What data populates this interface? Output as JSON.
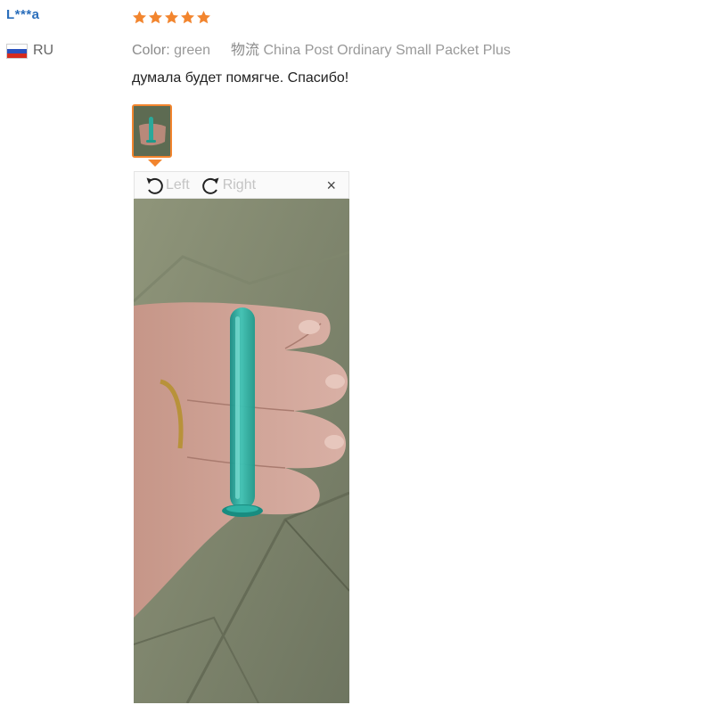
{
  "reviewer": {
    "name": "L***a",
    "country_code": "RU",
    "flag_icon": "russia-flag-icon"
  },
  "review": {
    "rating": 5,
    "rating_max": 5,
    "star_color": "#f2852e",
    "color_label": "Color:",
    "color_value": "green",
    "shipping_label": "物流",
    "shipping_value": "China Post Ordinary Small Packet Plus",
    "text": "думала будет помягче. Спасибо!"
  },
  "viewer": {
    "rotate_left_label": "Left",
    "rotate_right_label": "Right",
    "rotate_left_icon": "rotate-left-icon",
    "rotate_right_icon": "rotate-right-icon",
    "close_label": "×",
    "close_icon": "close-icon",
    "accent_color": "#f2852e"
  }
}
